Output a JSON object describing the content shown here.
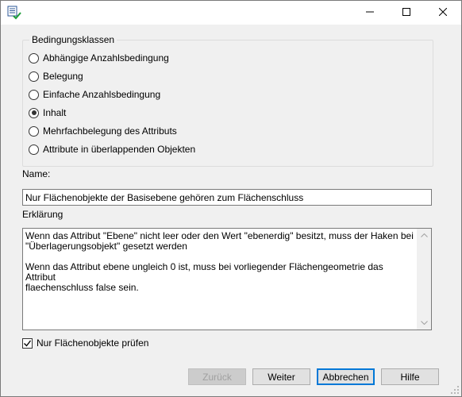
{
  "window": {
    "title": ""
  },
  "conditions": {
    "legend": "Bedingungsklassen",
    "options": [
      {
        "label": "Abhängige Anzahlsbedingung",
        "checked": false
      },
      {
        "label": "Belegung",
        "checked": false
      },
      {
        "label": "Einfache Anzahlsbedingung",
        "checked": false
      },
      {
        "label": "Inhalt",
        "checked": true
      },
      {
        "label": "Mehrfachbelegung des Attributs",
        "checked": false
      },
      {
        "label": "Attribute in überlappenden Objekten",
        "checked": false
      }
    ]
  },
  "name": {
    "label": "Name:",
    "value": "Nur Flächenobjekte der Basisebene gehören zum Flächenschluss"
  },
  "explanation": {
    "label": "Erklärung",
    "text": "Wenn das Attribut \"Ebene\" nicht leer oder den Wert \"ebenerdig\" besitzt, muss der Haken bei\n\"Überlagerungsobjekt\" gesetzt werden\n\nWenn das Attribut ebene ungleich 0 ist, muss bei vorliegender Flächengeometrie das Attribut\nflaechenschluss false sein."
  },
  "only_area_objects": {
    "label": "Nur Flächenobjekte prüfen",
    "checked": true
  },
  "buttons": {
    "back": "Zurück",
    "next": "Weiter",
    "cancel": "Abbrechen",
    "help": "Hilfe"
  },
  "icons": {
    "app": "checklist-icon",
    "minimize": "minimize-icon",
    "maximize": "maximize-icon",
    "close": "close-icon"
  }
}
